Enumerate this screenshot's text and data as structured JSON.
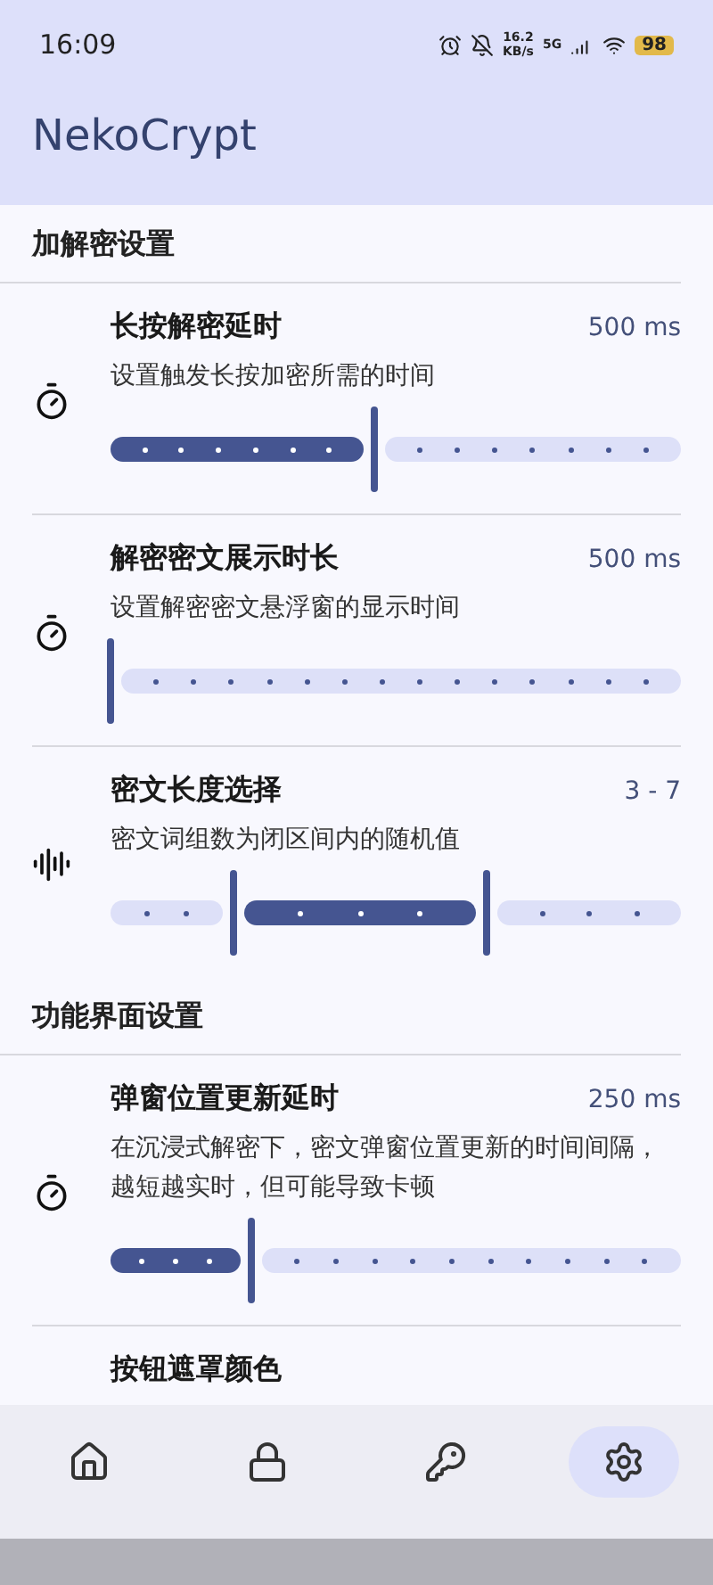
{
  "status_bar": {
    "time": "16:09",
    "net_speed": "16.2",
    "net_unit": "KB/s",
    "network": "5G",
    "battery": "98"
  },
  "app_bar": {
    "title": "NekoCrypt"
  },
  "sections": [
    {
      "title": "加解密设置",
      "items": [
        {
          "kind": "slider",
          "title": "长按解密延时",
          "value": "500 ms",
          "description": "设置触发长按加密所需的时间"
        },
        {
          "kind": "slider",
          "title": "解密密文展示时长",
          "value": "500 ms",
          "description": "设置解密密文悬浮窗的显示时间"
        },
        {
          "kind": "range",
          "title": "密文长度选择",
          "value": "3 - 7",
          "description": "密文词组数为闭区间内的随机值"
        }
      ]
    },
    {
      "title": "功能界面设置",
      "items": [
        {
          "kind": "slider",
          "title": "弹窗位置更新延时",
          "value": "250 ms",
          "description": "在沉浸式解密下，密文弹窗位置更新的时间间隔，越短越实时，但可能导致卡顿"
        },
        {
          "kind": "heading",
          "title": "按钮遮罩颜色"
        }
      ]
    }
  ],
  "nav": [
    {
      "selected": false
    },
    {
      "selected": false
    },
    {
      "selected": false
    },
    {
      "selected": true
    }
  ]
}
